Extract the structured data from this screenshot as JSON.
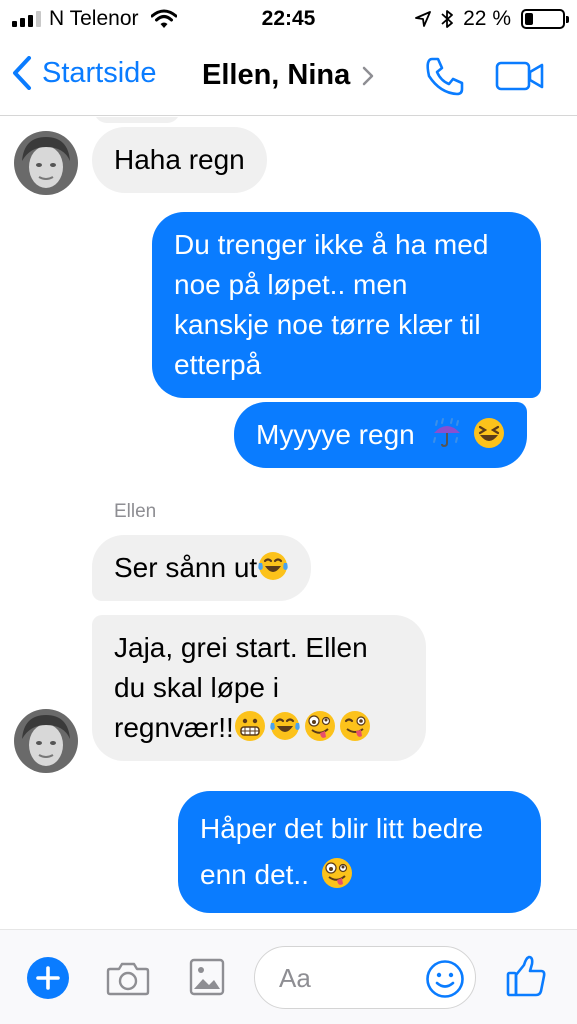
{
  "status_bar": {
    "carrier": "N Telenor",
    "time": "22:45",
    "battery_percent": "22 %",
    "battery_level": 0.22
  },
  "nav": {
    "back_label": "Startside",
    "title": "Ellen, Nina",
    "accent_color": "#0a7cff"
  },
  "messages": [
    {
      "direction": "in",
      "text": "Haha regn"
    },
    {
      "direction": "out",
      "lines": [
        "Du trenger ikke å ha med",
        "noe på løpet.. men",
        "kanskje noe tørre klær til",
        "etterpå"
      ]
    },
    {
      "direction": "out",
      "text": "Myyyye regn",
      "emojis": [
        "umbrella-rain",
        "laughing-squint"
      ]
    },
    {
      "direction": "in",
      "sender": "Ellen",
      "text": "Ser sånn ut",
      "emojis": [
        "tears-of-joy"
      ]
    },
    {
      "direction": "in",
      "lines": [
        "Jaja, grei start. Ellen",
        "du skal løpe i",
        "regnvær!!"
      ],
      "emojis": [
        "grimacing",
        "tears-of-joy",
        "zany",
        "winking-tongue"
      ]
    },
    {
      "direction": "out",
      "lines": [
        "Håper det blir litt bedre",
        "enn det.."
      ],
      "emojis": [
        "zany"
      ]
    }
  ],
  "composer": {
    "placeholder": "Aa"
  }
}
